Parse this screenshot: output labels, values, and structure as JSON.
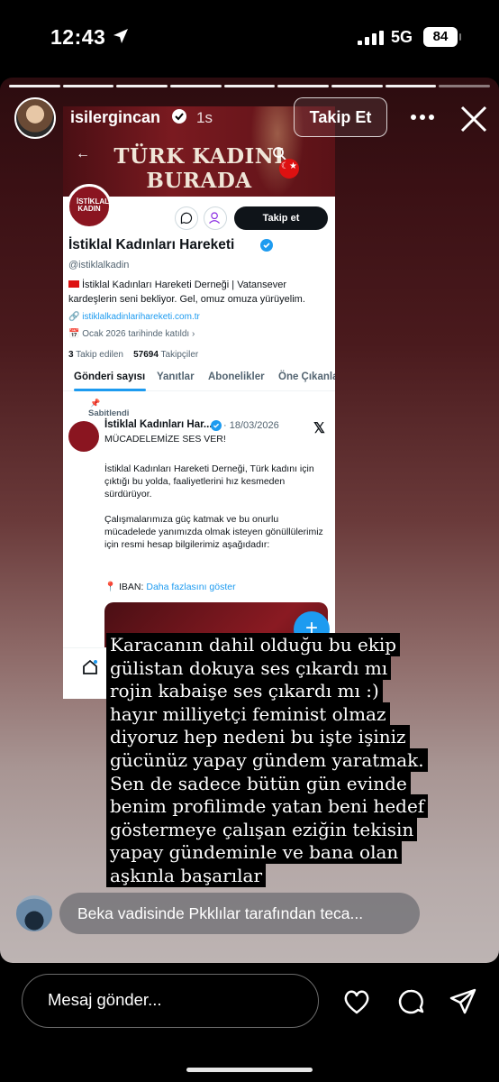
{
  "status_bar": {
    "time": "12:43",
    "network": "5G",
    "battery": "84"
  },
  "story": {
    "username": "isilergincan",
    "time_ago": "1s",
    "follow_button": "Takip Et"
  },
  "embedded": {
    "banner_text": "TÜRK KADINI BURADA",
    "follow_button": "Takip et",
    "account_name": "İstiklal Kadınları Hareketi",
    "handle": "@istiklalkadin",
    "bio": "İstiklal Kadınları Hareketi Derneği | Vatansever kardeşlerin seni bekliyor. Gel, omuz omuza yürüyelim.",
    "link": "istiklalkadinlarihareketi.com.tr",
    "joined": "Ocak 2026 tarihinde katıldı",
    "following_count": "3",
    "following_label": "Takip edilen",
    "followers_count": "57694",
    "followers_label": "Takipçiler",
    "tabs": [
      "Gönderi sayısı",
      "Yanıtlar",
      "Abonelikler",
      "Öne Çıkanla"
    ],
    "pinned_label": "Sabitlendi",
    "tweet": {
      "author": "İstiklal Kadınları Har...",
      "date": "· 18/03/2026",
      "headline": "MÜCADELEMİZE SES VER!",
      "body": "İstiklal Kadınları Hareketi Derneği, Türk kadını için çıktığı bu yolda, faaliyetlerini hız kesmeden sürdürüyor.\n\nÇalışmalarımıza güç katmak ve bu onurlu mücadelede yanımızda olmak isteyen gönüllülerimiz için resmi hesap bilgilerimiz aşağıdadır:",
      "iban_label": "IBAN:",
      "show_more": "Daha fazlasını göster"
    }
  },
  "caption": "Karacanın dahil olduğu bu ekip gülistan dokuya ses çıkardı mı rojin kabaişe ses çıkardı mı :) hayır milliyetçi feminist olmaz diyoruz hep nedeni bu işte işiniz gücünüz yapay gündem yaratmak. Sen de sadece bütün gün evinde benim profilimde  yatan beni hedef göstermeye çalışan eziğin tekisin yapay gündeminle ve bana olan aşkınla başarılar",
  "reply_preview": "Beka vadisinde Pkklılar tarafından teca...",
  "bottom_bar": {
    "message_placeholder": "Mesaj gönder..."
  }
}
